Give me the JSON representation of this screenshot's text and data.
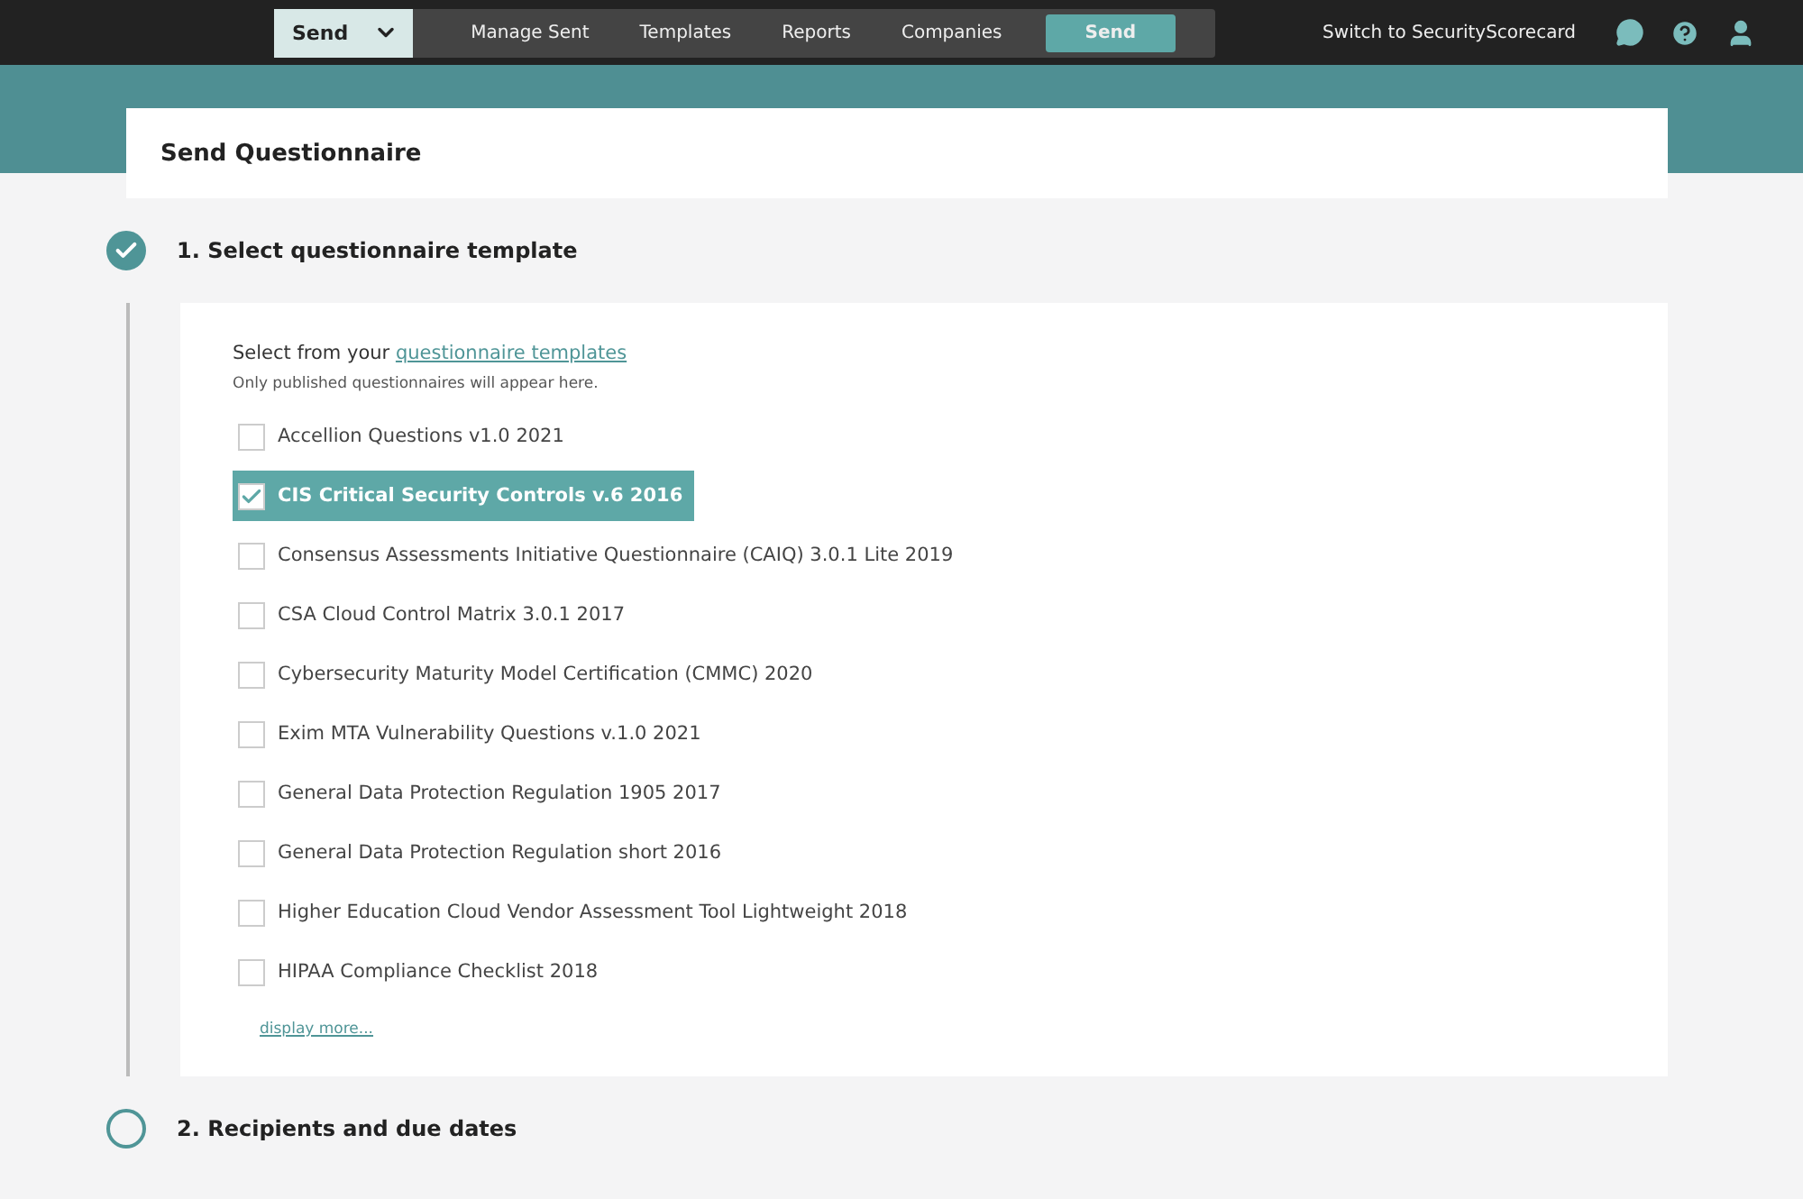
{
  "nav": {
    "dropdown": {
      "label": "Send"
    },
    "links": [
      {
        "label": "Manage Sent",
        "selected": false
      },
      {
        "label": "Templates",
        "selected": false
      },
      {
        "label": "Reports",
        "selected": false
      },
      {
        "label": "Companies",
        "selected": false
      },
      {
        "label": "Send",
        "selected": true
      }
    ],
    "switch_link": "Switch to SecurityScorecard"
  },
  "page_title": "Send Questionnaire",
  "steps": [
    {
      "title": "1. Select questionnaire template",
      "completed": true,
      "intro": "Select from your ",
      "intro_link": "questionnaire templates",
      "note": "Only published questionnaires will appear here.",
      "templates": [
        {
          "label": "Accellion Questions v1.0 2021",
          "checked": false
        },
        {
          "label": "CIS Critical Security Controls v.6 2016",
          "checked": true
        },
        {
          "label": "Consensus Assessments Initiative Questionnaire (CAIQ) 3.0.1 Lite 2019",
          "checked": false
        },
        {
          "label": "CSA Cloud Control Matrix 3.0.1 2017",
          "checked": false
        },
        {
          "label": "Cybersecurity Maturity Model Certification (CMMC) 2020",
          "checked": false
        },
        {
          "label": "Exim MTA Vulnerability Questions v.1.0 2021",
          "checked": false
        },
        {
          "label": "General Data Protection Regulation 1905 2017",
          "checked": false
        },
        {
          "label": "General Data Protection Regulation short 2016",
          "checked": false
        },
        {
          "label": "Higher Education Cloud Vendor Assessment Tool Lightweight 2018",
          "checked": false
        },
        {
          "label": "HIPAA Compliance Checklist 2018",
          "checked": false
        }
      ],
      "more_link": "display more..."
    },
    {
      "title": "2. Recipients and due dates",
      "completed": false
    }
  ]
}
